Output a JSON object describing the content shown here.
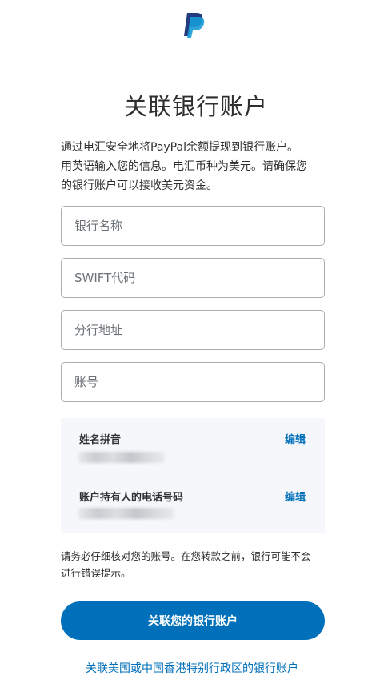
{
  "brand": {
    "logo_icon": "paypal-logo-icon",
    "logo_dark": "#253b80",
    "logo_light": "#179bd7"
  },
  "header": {
    "title": "关联银行账户"
  },
  "intro": {
    "line1": "通过电汇安全地将PayPal余额提现到银行账户。",
    "line2": "用英语输入您的信息。电汇币种为美元。请确保您",
    "line3": "的银行账户可以接收美元资金。"
  },
  "form": {
    "bank_name": {
      "placeholder": "银行名称",
      "value": ""
    },
    "swift_code": {
      "placeholder": "SWIFT代码",
      "value": ""
    },
    "branch_address": {
      "placeholder": "分行地址",
      "value": ""
    },
    "account_number": {
      "placeholder": "账号",
      "value": ""
    }
  },
  "info": {
    "name": {
      "label": "姓名拼音",
      "edit": "编辑"
    },
    "phone": {
      "label": "账户持有人的电话号码",
      "edit": "编辑"
    }
  },
  "note": {
    "line1": "请务必仔细核对您的账号。在您转款之前，银行可能不会",
    "line2": "进行错误提示。"
  },
  "actions": {
    "link_button": "关联您的银行账户",
    "alt_link": "关联美国或中国香港特别行政区的银行账户"
  },
  "colors": {
    "accent": "#0070ba",
    "panel": "#f5f7fa",
    "border": "#a9acb0"
  }
}
